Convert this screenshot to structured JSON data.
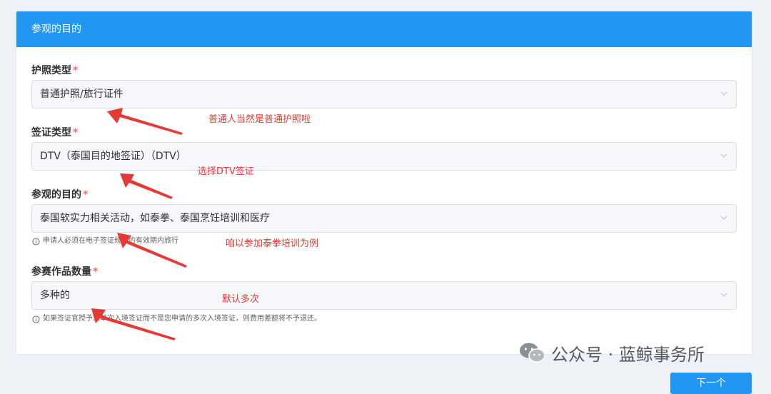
{
  "card": {
    "title": "参观的目的"
  },
  "fields": [
    {
      "label": "护照类型",
      "required": "*",
      "value": "普通护照/旅行证件"
    },
    {
      "label": "签证类型",
      "required": "*",
      "value": "DTV（泰国目的地签证）（DTV）"
    },
    {
      "label": "参观的目的",
      "required": "*",
      "value": "泰国软实力相关活动，如泰拳、泰国烹饪培训和医疗",
      "hint": "申请人必须在电子签证规定的有效期内旅行"
    },
    {
      "label": "参赛作品数量",
      "required": "*",
      "value": "多种的",
      "hint": "如果签证官授予您单次入境签证而不是您申请的多次入境签证，则费用差额将不予退还。"
    }
  ],
  "annotations": [
    "普通人当然是普通护照啦",
    "选择DTV签证",
    "咱以参加泰拳培训为例",
    "默认多次"
  ],
  "watermark": "公众号 · 蓝鲸事务所",
  "next_button": "下一个",
  "colors": {
    "header": "#2196f3",
    "annotation": "#e53935",
    "required": "#f56c6c"
  }
}
